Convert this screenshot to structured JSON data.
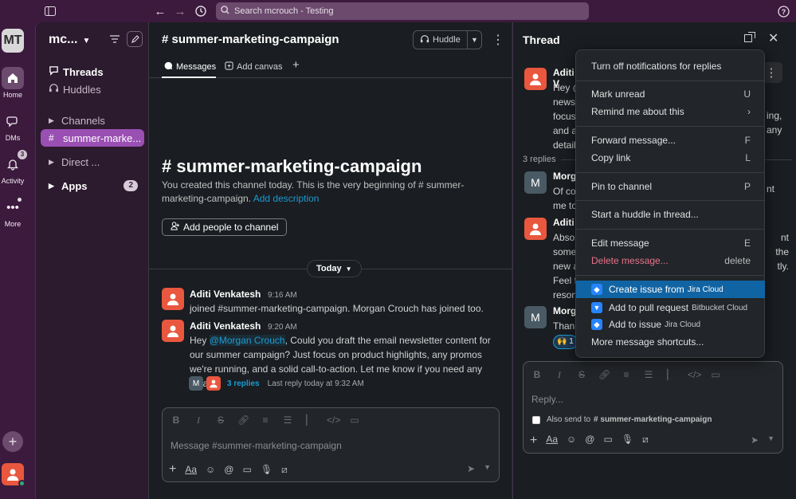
{
  "topbar": {
    "search_placeholder": "Search mcrouch - Testing",
    "icons": [
      "sidebar-toggle-icon",
      "back-arrow-icon",
      "forward-arrow-icon",
      "history-icon",
      "search-icon",
      "help-icon"
    ]
  },
  "rail": {
    "workspace_initials": "MT",
    "items": [
      {
        "label": "Home",
        "icon": "home-icon"
      },
      {
        "label": "DMs",
        "icon": "dm-icon"
      },
      {
        "label": "Activity",
        "icon": "bell-icon",
        "badge": "3"
      },
      {
        "label": "More",
        "icon": "more-icon"
      }
    ]
  },
  "sidebar": {
    "workspace_name": "mc...",
    "items": [
      {
        "label": "Threads",
        "icon": "threads-icon"
      },
      {
        "label": "Huddles",
        "icon": "headphones-icon"
      },
      {
        "label": "Channels",
        "icon": "caret-right-icon"
      },
      {
        "label": "summer-marke...",
        "icon": "hash-icon"
      },
      {
        "label": "Direct ...",
        "icon": "caret-right-icon"
      },
      {
        "label": "Apps",
        "icon": "caret-right-icon",
        "badge": "2"
      }
    ]
  },
  "channel": {
    "title": "# summer-marketing-campaign",
    "huddle_label": "Huddle",
    "tabs": [
      {
        "label": "Messages"
      },
      {
        "label": "Add canvas"
      }
    ],
    "intro_title": "# summer-marketing-campaign",
    "intro_text": "You created this channel today. This is the very beginning of # summer-marketing-campaign.",
    "intro_link": "Add description",
    "add_people": "Add people to channel",
    "date_divider": "Today",
    "messages": [
      {
        "author": "Aditi Venkatesh",
        "time": "9:16 AM",
        "text": "joined #summer-marketing-campaign. Morgan Crouch has joined too."
      },
      {
        "author": "Aditi Venkatesh",
        "time": "9:20 AM",
        "text_before": "Hey ",
        "mention": "@Morgan Crouch",
        "text_after": ", Could you draft the email newsletter content for our summer campaign? Just focus on product highlights, any promos we're running, and a solid call-to-action. Let me know if you need any details!",
        "replies_link": "3 replies",
        "replies_meta": "Last reply today at 9:32 AM",
        "reply_avatar_initial": "M"
      }
    ],
    "composer_placeholder": "Message #summer-marketing-campaign"
  },
  "thread": {
    "title": "Thread",
    "replies_label": "3 replies",
    "messages": [
      {
        "author": "Aditi V",
        "lines": [
          "Hey @",
          "newsl",
          "focus",
          "and a",
          "detail"
        ],
        "right_lines": [
          "ing,",
          "any"
        ]
      },
      {
        "author": "Morg",
        "avatar_initial": "M",
        "lines": [
          "Of co",
          "me to"
        ],
        "right_lines": [
          "nt"
        ]
      },
      {
        "author": "Aditi",
        "lines": [
          "Absol",
          "some",
          "new a",
          "Feel f",
          "reson"
        ],
        "right_lines": [
          "nt",
          "the",
          "tly."
        ]
      },
      {
        "author": "Morg",
        "avatar_initial": "M",
        "lines": [
          "Thank"
        ],
        "reaction": "🙌 1"
      }
    ],
    "composer_placeholder": "Reply...",
    "also_send_prefix": "Also send to",
    "also_send_channel": "# summer-marketing-campaign"
  },
  "context_menu": {
    "items": [
      {
        "label": "Turn off notifications for replies",
        "shortcut": ""
      },
      {
        "label": "Mark unread",
        "shortcut": "U"
      },
      {
        "label": "Remind me about this",
        "shortcut": "›"
      },
      {
        "label": "Forward message...",
        "shortcut": "F"
      },
      {
        "label": "Copy link",
        "shortcut": "L"
      },
      {
        "label": "Pin to channel",
        "shortcut": "P"
      },
      {
        "label": "Start a huddle in thread...",
        "shortcut": ""
      },
      {
        "label": "Edit message",
        "shortcut": "E"
      },
      {
        "label": "Delete message...",
        "shortcut": "delete"
      },
      {
        "label": "Create issue from",
        "suffix": "Jira Cloud"
      },
      {
        "label": "Add to pull request",
        "suffix": "Bitbucket Cloud"
      },
      {
        "label": "Add to issue",
        "suffix": "Jira Cloud"
      },
      {
        "label": "More message shortcuts...",
        "shortcut": ""
      }
    ]
  },
  "colors": {
    "aubergine": "#3b1a3d",
    "selected": "#9a4fb3",
    "link": "#1d9bd1",
    "menu_highlight": "#1164a3",
    "danger": "#e8728a"
  }
}
